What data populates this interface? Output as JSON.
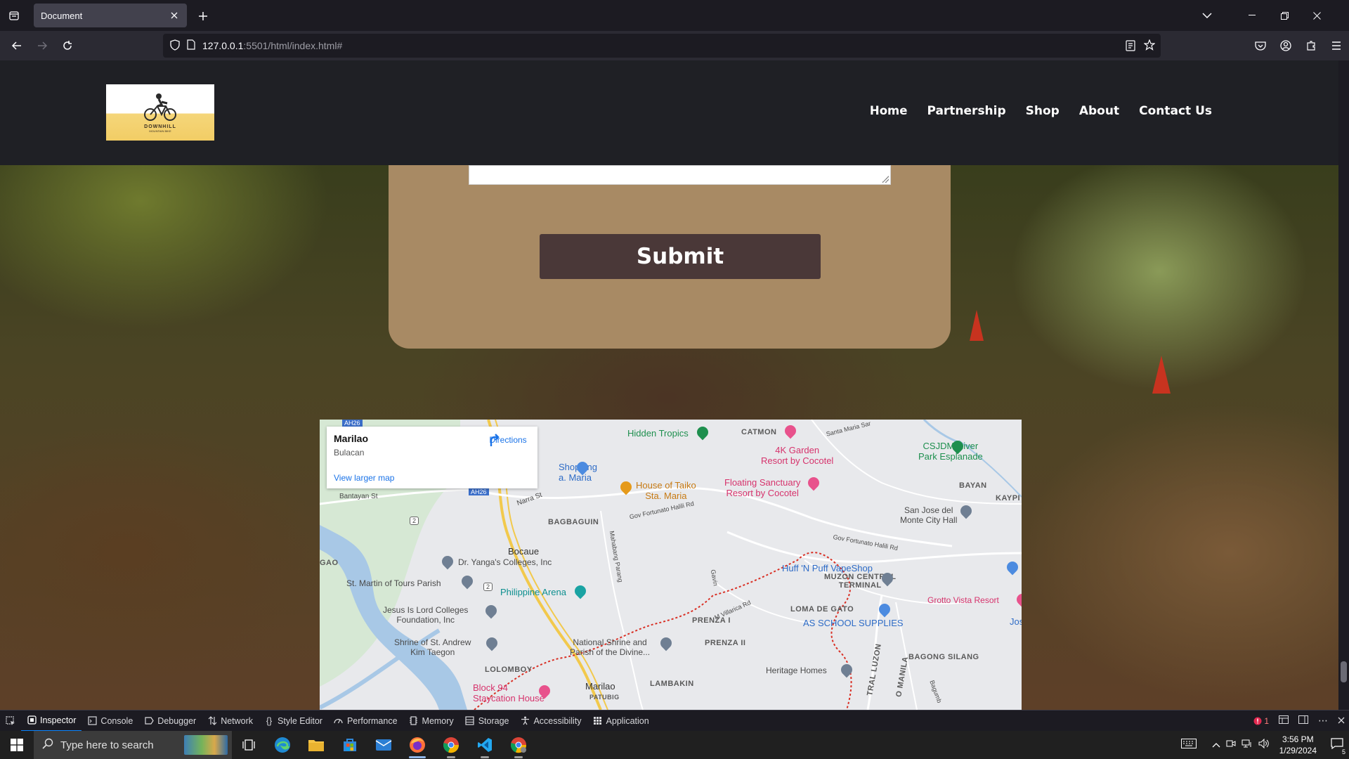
{
  "browser": {
    "tab_title": "Document",
    "url_host": "127.0.0.1",
    "url_rest": ":5501/html/index.html#"
  },
  "site": {
    "logo_text": "DOWNHILL",
    "logo_sub": "MOUNTAIN BIKE",
    "nav": [
      "Home",
      "Partnership",
      "Shop",
      "About",
      "Contact Us"
    ],
    "submit_label": "Submit"
  },
  "map": {
    "place_name": "Marilao",
    "place_region": "Bulacan",
    "directions_label": "Directions",
    "view_larger": "View larger map",
    "labels": {
      "hidden_tropics": "Hidden Tropics",
      "catmon": "CATMON",
      "garden": "4K Garden\nResort by Cocotel",
      "csjdm": "CSJDM River\nPark Esplanade",
      "floating": "Floating Sanctuary\nResort by Cocotel",
      "taiko": "House of Taiko\nSta. Maria",
      "shopping": "Shopping\na. Maria",
      "bayan": "BAYAN",
      "kaypi": "KAYPI",
      "sjdm": "San Jose del\nMonte City Hall",
      "bagbaguin": "BAGBAGUIN",
      "bocaue": "Bocaue",
      "gao": "GAO",
      "yanga": "Dr. Yanga's Colleges, Inc",
      "huff": "Huff 'N Puff VapeShop",
      "muzon": "MUZON CENTRAL\nTERMINAL",
      "stmartin": "St. Martin of Tours Parish",
      "phil_arena": "Philippine Arena",
      "grotto": "Grotto Vista Resort",
      "jesus": "Jesus Is Lord Colleges\nFoundation, Inc",
      "loma": "LOMA DE GATO",
      "as_school": "AS SCHOOL SUPPLIES",
      "jose": "Jose",
      "prenza_i": "PRENZA I",
      "prenza_ii": "PRENZA II",
      "shrine_andrew": "Shrine of St. Andrew\nKim Taegon",
      "national_shrine": "National Shrine and\nParish of the Divine...",
      "lolomboy": "LOLOMBOY",
      "heritage": "Heritage Homes",
      "bagong": "BAGONG SILANG",
      "block94": "Block 94\nStaycation House",
      "marilao": "Marilao",
      "lambakin": "LAMBAKIN",
      "patubig": "PATUBIG",
      "bantayan": "Bantayan St",
      "narra": "Narra St",
      "gov_fortunato": "Gov Fortunato Halili Rd",
      "gov_fortunato2": "Gov Fortunato Halili Rd",
      "ah26a": "AH26",
      "ah26b": "AH26",
      "r2a": "2",
      "r2b": "2",
      "mahabang": "Mahabang Parang",
      "villarica": "M Villarica Rd",
      "santa_maria": "Santa Maria Sar",
      "tral_luzon": "TRAL LUZON",
      "o_manila": "O MANILA",
      "bagumbong": "Bagumb",
      "gavino": "Gavin"
    }
  },
  "devtools": {
    "tabs": [
      "Inspector",
      "Console",
      "Debugger",
      "Network",
      "Style Editor",
      "Performance",
      "Memory",
      "Storage",
      "Accessibility",
      "Application"
    ],
    "error_count": "1"
  },
  "taskbar": {
    "search_placeholder": "Type here to search",
    "time": "3:56 PM",
    "date": "1/29/2024",
    "notif_count": "5"
  }
}
